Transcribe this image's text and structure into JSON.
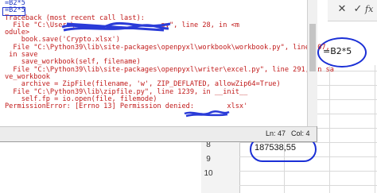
{
  "excel": {
    "toolbar": {
      "close_symbol": "✕",
      "check_symbol": "✓",
      "fx_symbol": "fx"
    },
    "formula_annotation": "=B2*5",
    "row_numbers": [
      "8",
      "9",
      "10"
    ],
    "cell_value": "187538,55"
  },
  "shell": {
    "lines": [
      {
        "text": "=B2*5",
        "color": "blue"
      },
      {
        "text": "=B2*5",
        "color": "blue"
      },
      {
        "text": "Traceback (most recent call last):",
        "color": "red"
      },
      {
        "text": "  File \"C:\\Users\\                    .py\", line 28, in <m",
        "color": "red"
      },
      {
        "text": "odule>",
        "color": "red"
      },
      {
        "text": "    book.save('Crypto.xlsx')",
        "color": "red"
      },
      {
        "text": "  File \"C:\\Python39\\lib\\site-packages\\openpyxl\\workbook\\workbook.py\", line 407,",
        "color": "red"
      },
      {
        "text": " in save",
        "color": "red"
      },
      {
        "text": "    save_workbook(self, filename)",
        "color": "red"
      },
      {
        "text": "  File \"C:\\Python39\\lib\\site-packages\\openpyxl\\writer\\excel.py\", line 291, in sa",
        "color": "red"
      },
      {
        "text": "ve_workbook",
        "color": "red"
      },
      {
        "text": "    archive = ZipFile(filename, 'w', ZIP_DEFLATED, allowZip64=True)",
        "color": "red"
      },
      {
        "text": "  File \"C:\\Python39\\lib\\zipfile.py\", line 1239, in __init__",
        "color": "red"
      },
      {
        "text": "    self.fp = io.open(file, filemode)",
        "color": "red"
      },
      {
        "text": "PermissionError: [Errno 13] Permission denied:        xlsx'",
        "color": "red"
      }
    ],
    "status": {
      "line": "Ln: 47",
      "col": "Col: 4"
    }
  }
}
